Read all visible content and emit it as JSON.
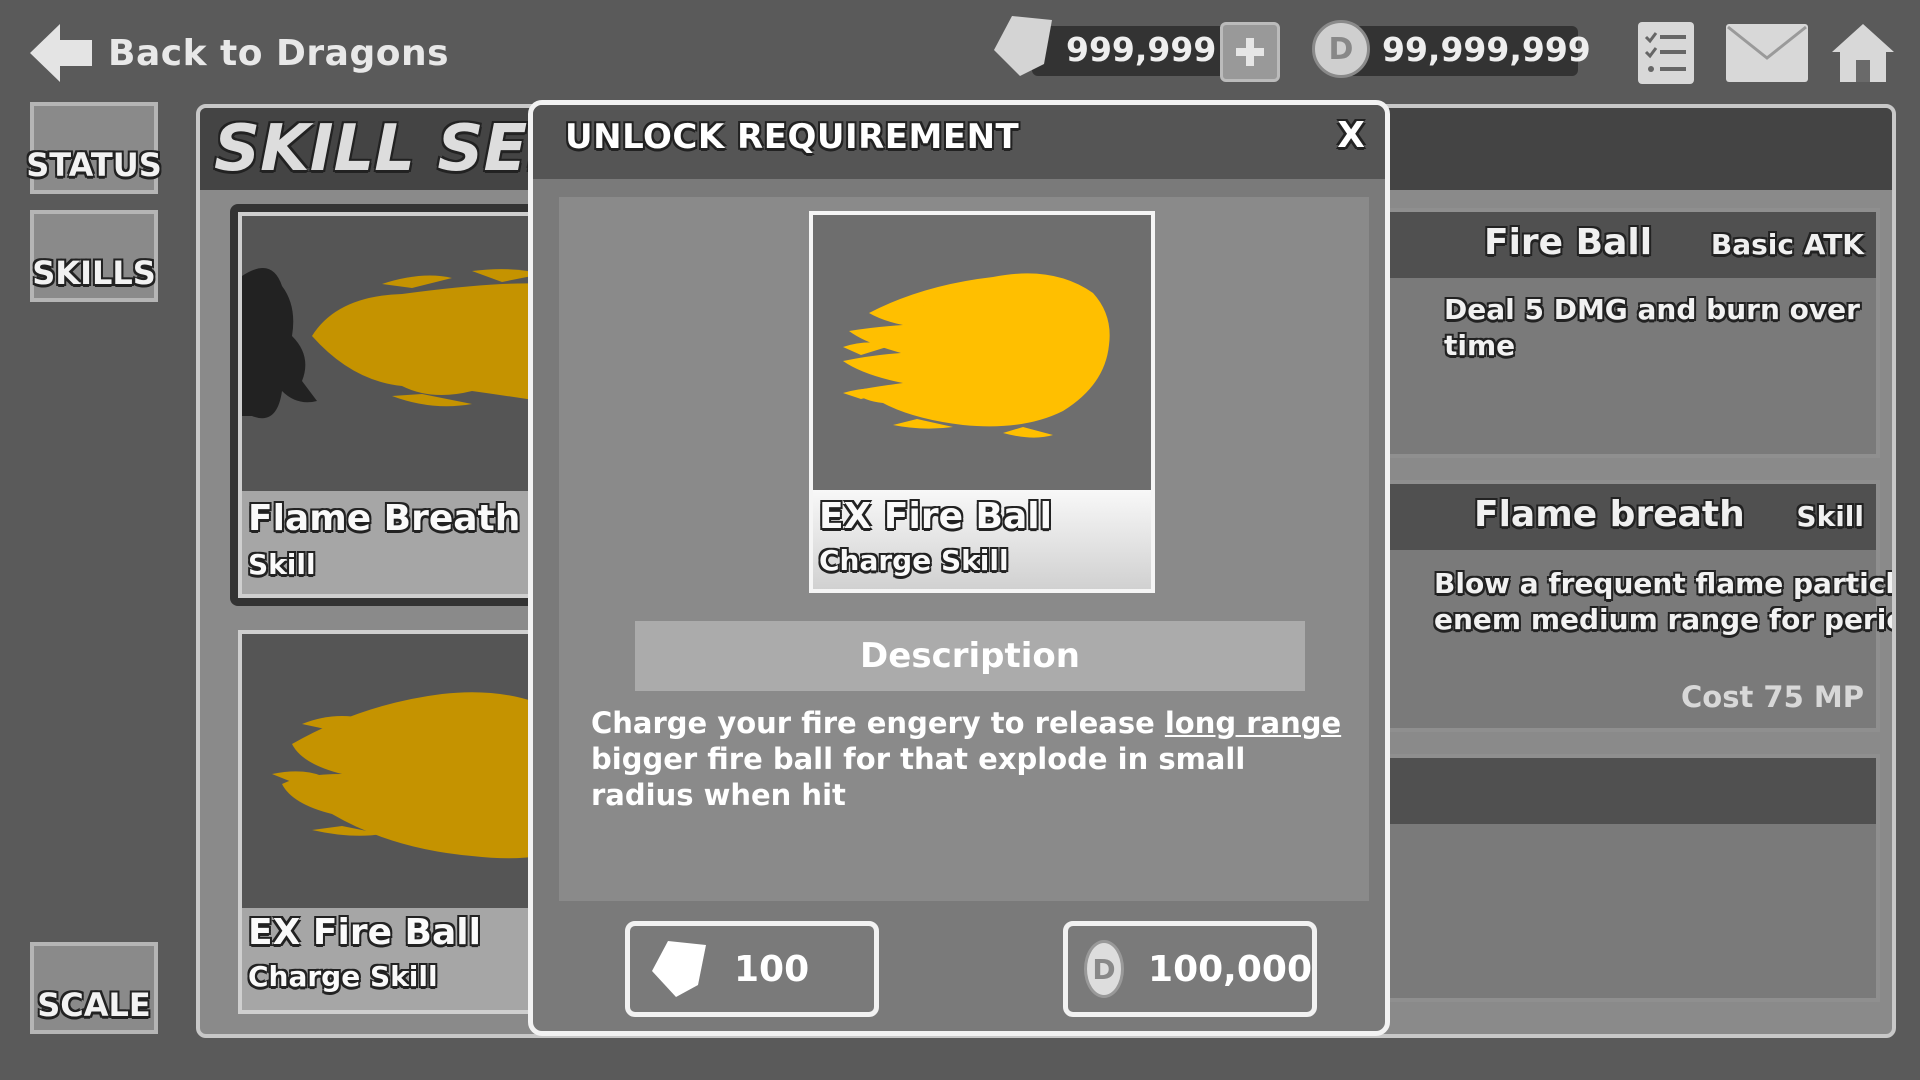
{
  "topbar": {
    "back_label": "Back to Dragons",
    "gems": "999,999",
    "coins": "99,999,999",
    "coin_letter": "D"
  },
  "nav": {
    "status": "STATUS",
    "skills": "SKILLS",
    "scale": "SCALE"
  },
  "panel": {
    "title": "SKILL SELECTION",
    "cards": [
      {
        "name": "Flame Breath",
        "type": "Skill"
      },
      {
        "name": "EX Fire Ball",
        "type": "Charge Skill"
      }
    ],
    "details": [
      {
        "name": "Fire Ball",
        "type": "Basic ATK",
        "text": "Deal 5 DMG and burn over time"
      },
      {
        "name": "Flame breath",
        "type": "Skill",
        "text_1": "Blow a frequent flame particle at your",
        "text_2": "enem medium range for period of second.",
        "cost": "Cost 75 MP"
      }
    ]
  },
  "modal": {
    "title": "UNLOCK REQUIREMENT",
    "close": "X",
    "skill_name": "EX Fire Ball",
    "skill_type": "Charge Skill",
    "description_label": "Description",
    "description_before": "Charge your fire engery to release ",
    "description_link": "long range",
    "description_after": " bigger fire ball for that explode in small radius when hit",
    "gem_price": "100",
    "coin_price": "100,000"
  },
  "colors": {
    "flame": "#ffbf00",
    "flame_dim": "#c59300",
    "background": "#5a5a5a"
  }
}
